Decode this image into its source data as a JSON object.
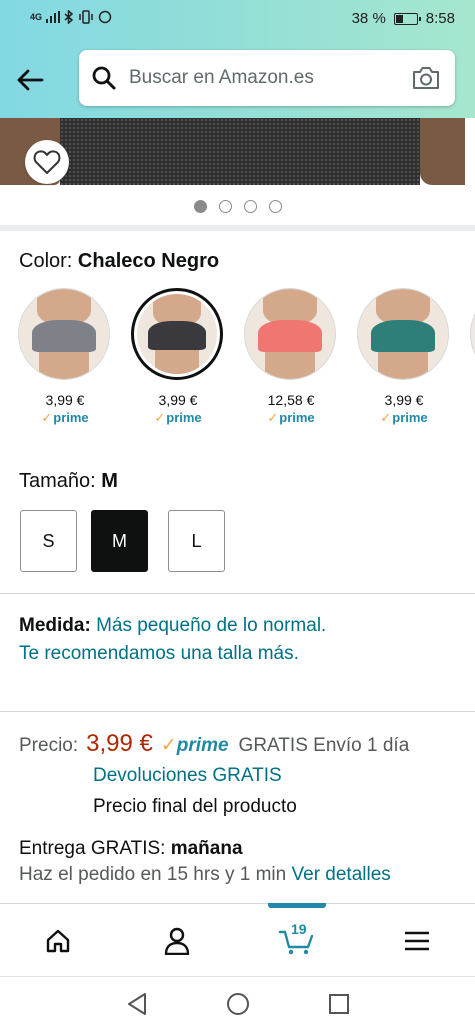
{
  "status_bar": {
    "network": "4G",
    "battery_text": "38 %",
    "battery_level": 0.38,
    "time": "8:58"
  },
  "header": {
    "search_placeholder": "Buscar en Amazon.es"
  },
  "gallery": {
    "dot_count": 4,
    "active_index": 0
  },
  "color": {
    "label": "Color:",
    "selected": "Chaleco Negro",
    "options": [
      {
        "price": "3,99 €",
        "prime": "prime",
        "color": "#7f8189",
        "selected": false
      },
      {
        "price": "3,99 €",
        "prime": "prime",
        "color": "#3a3a3e",
        "selected": true
      },
      {
        "price": "12,58 €",
        "prime": "prime",
        "color": "#f07672",
        "selected": false
      },
      {
        "price": "3,99 €",
        "prime": "prime",
        "color": "#2e7f7a",
        "selected": false
      }
    ]
  },
  "size": {
    "label": "Tamaño:",
    "selected": "M",
    "options": [
      "S",
      "M",
      "L"
    ]
  },
  "fit": {
    "label": "Medida:",
    "text": "Más pequeño de lo normal. Te recomendamos una talla más."
  },
  "price": {
    "label": "Precio:",
    "value": "3,99 €",
    "prime": "prime",
    "shipping": "GRATIS Envío 1 día",
    "returns": "Devoluciones GRATIS",
    "final_note": "Precio final del producto"
  },
  "delivery": {
    "label": "Entrega GRATIS:",
    "day": "mañana",
    "order_text": "Haz el pedido en 15 hrs y 1 min",
    "details_link": "Ver detalles"
  },
  "bottom_nav": {
    "cart_count": "19"
  },
  "colors": {
    "teal_link": "#007185",
    "price_red": "#b12704",
    "prime_blue": "#1f8aa6",
    "prime_check": "#f3a847"
  }
}
